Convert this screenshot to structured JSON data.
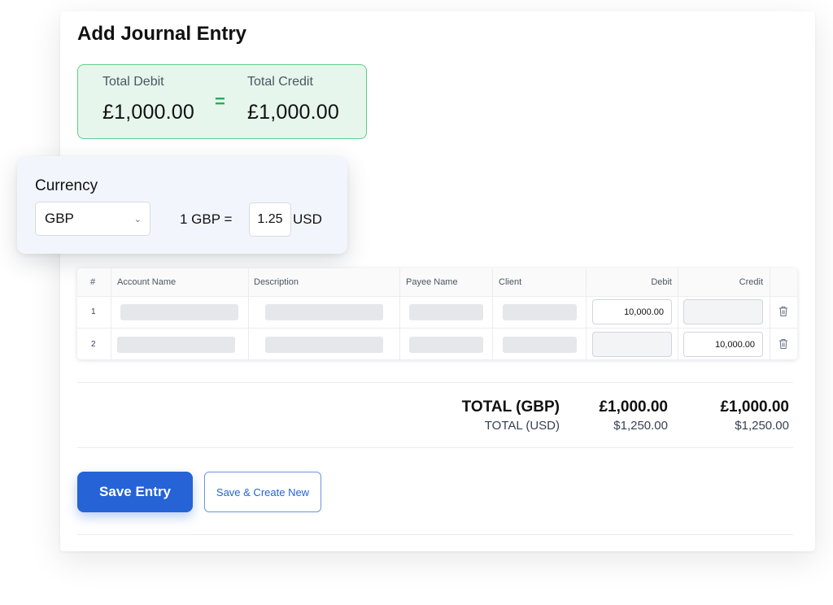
{
  "page": {
    "title": "Add Journal Entry"
  },
  "balance": {
    "debit_label": "Total Debit",
    "debit_value": "£1,000.00",
    "equals": "=",
    "credit_label": "Total Credit",
    "credit_value": "£1,000.00",
    "accent_color": "#22b05b"
  },
  "currency": {
    "label": "Currency",
    "selected": "GBP",
    "rate_prefix": "1 GBP =",
    "rate_value": "1.25",
    "rate_suffix": "USD"
  },
  "table": {
    "headers": {
      "num": "#",
      "account": "Account Name",
      "description": "Description",
      "payee": "Payee Name",
      "client": "Client",
      "debit": "Debit",
      "credit": "Credit"
    },
    "rows": [
      {
        "num": "1",
        "debit": "10,000.00",
        "credit": ""
      },
      {
        "num": "2",
        "debit": "",
        "credit": "10,000.00"
      }
    ]
  },
  "totals": {
    "gbp_label": "TOTAL (GBP)",
    "usd_label": "TOTAL (USD)",
    "debit_gbp": "£1,000.00",
    "credit_gbp": "£1,000.00",
    "debit_usd": "$1,250.00",
    "credit_usd": "$1,250.00"
  },
  "actions": {
    "save_label": "Save Entry",
    "save_new_label": "Save & Create New",
    "primary_color": "#2563d6"
  }
}
